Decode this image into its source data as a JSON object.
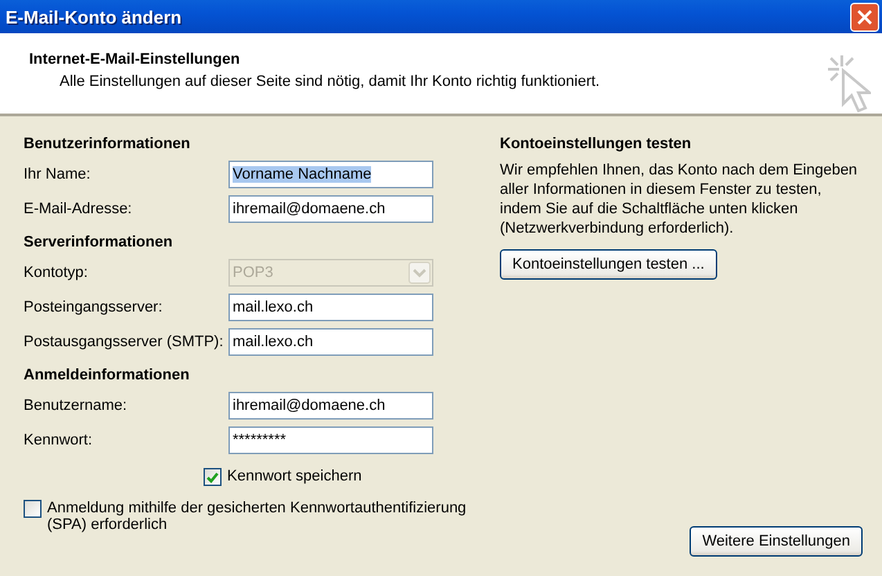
{
  "window": {
    "title": "E-Mail-Konto ändern"
  },
  "header": {
    "title": "Internet-E-Mail-Einstellungen",
    "subtitle": "Alle Einstellungen auf dieser Seite sind nötig, damit Ihr Konto richtig funktioniert."
  },
  "sections": [
    {
      "heading": "Benutzerinformationen",
      "fields": [
        {
          "kind": "text",
          "label": "Ihr Name:",
          "value": "Vorname Nachname",
          "highlighted": true
        },
        {
          "kind": "text",
          "label": "E-Mail-Adresse:",
          "value": "ihremail@domaene.ch",
          "highlighted": false
        }
      ]
    },
    {
      "heading": "Serverinformationen",
      "fields": [
        {
          "kind": "select",
          "label": "Kontotyp:",
          "value": "POP3",
          "disabled": true
        },
        {
          "kind": "text",
          "label": "Posteingangsserver:",
          "value": "mail.lexo.ch",
          "highlighted": false
        },
        {
          "kind": "text",
          "label": "Postausgangsserver (SMTP):",
          "value": "mail.lexo.ch",
          "highlighted": false
        }
      ]
    },
    {
      "heading": "Anmeldeinformationen",
      "fields": [
        {
          "kind": "text",
          "label": "Benutzername:",
          "value": "ihremail@domaene.ch",
          "highlighted": false
        },
        {
          "kind": "text",
          "label": "Kennwort:",
          "value": "*********",
          "highlighted": false
        }
      ]
    }
  ],
  "save_password": {
    "label": "Kennwort speichern",
    "checked": true
  },
  "spa": {
    "label": "Anmeldung mithilfe der gesicherten Kennwortauthentifizierung (SPA) erforderlich",
    "checked": false
  },
  "test": {
    "heading": "Kontoeinstellungen testen",
    "text": "Wir empfehlen Ihnen, das Konto nach dem Eingeben aller Informationen in diesem Fenster zu testen, indem Sie auf die Schaltfläche unten klicken (Netzwerkverbindung erforderlich).",
    "button": "Kontoeinstellungen testen ..."
  },
  "more_button": "Weitere Einstellungen"
}
